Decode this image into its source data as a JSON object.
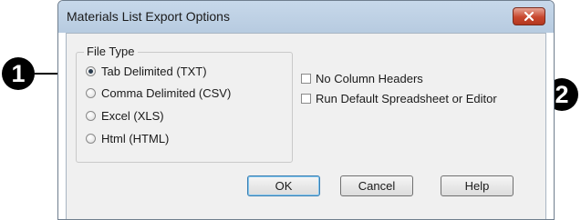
{
  "callouts": {
    "one": "1",
    "two": "2"
  },
  "dialog": {
    "title": "Materials List Export Options",
    "close_icon": "close-x-icon",
    "file_type": {
      "label": "File Type",
      "options": [
        {
          "label": "Tab Delimited (TXT)",
          "selected": true
        },
        {
          "label": "Comma Delimited (CSV)",
          "selected": false
        },
        {
          "label": "Excel (XLS)",
          "selected": false
        },
        {
          "label": "Html (HTML)",
          "selected": false
        }
      ]
    },
    "checkboxes": [
      {
        "label": "No Column Headers",
        "checked": false
      },
      {
        "label": "Run Default Spreadsheet or Editor",
        "checked": false
      }
    ],
    "buttons": {
      "ok": "OK",
      "cancel": "Cancel",
      "help": "Help"
    }
  },
  "colors": {
    "titlebar": "#c7d8ea",
    "close_button": "#c8472e",
    "dialog_body": "#f0f0f0",
    "callout": "#000000"
  }
}
